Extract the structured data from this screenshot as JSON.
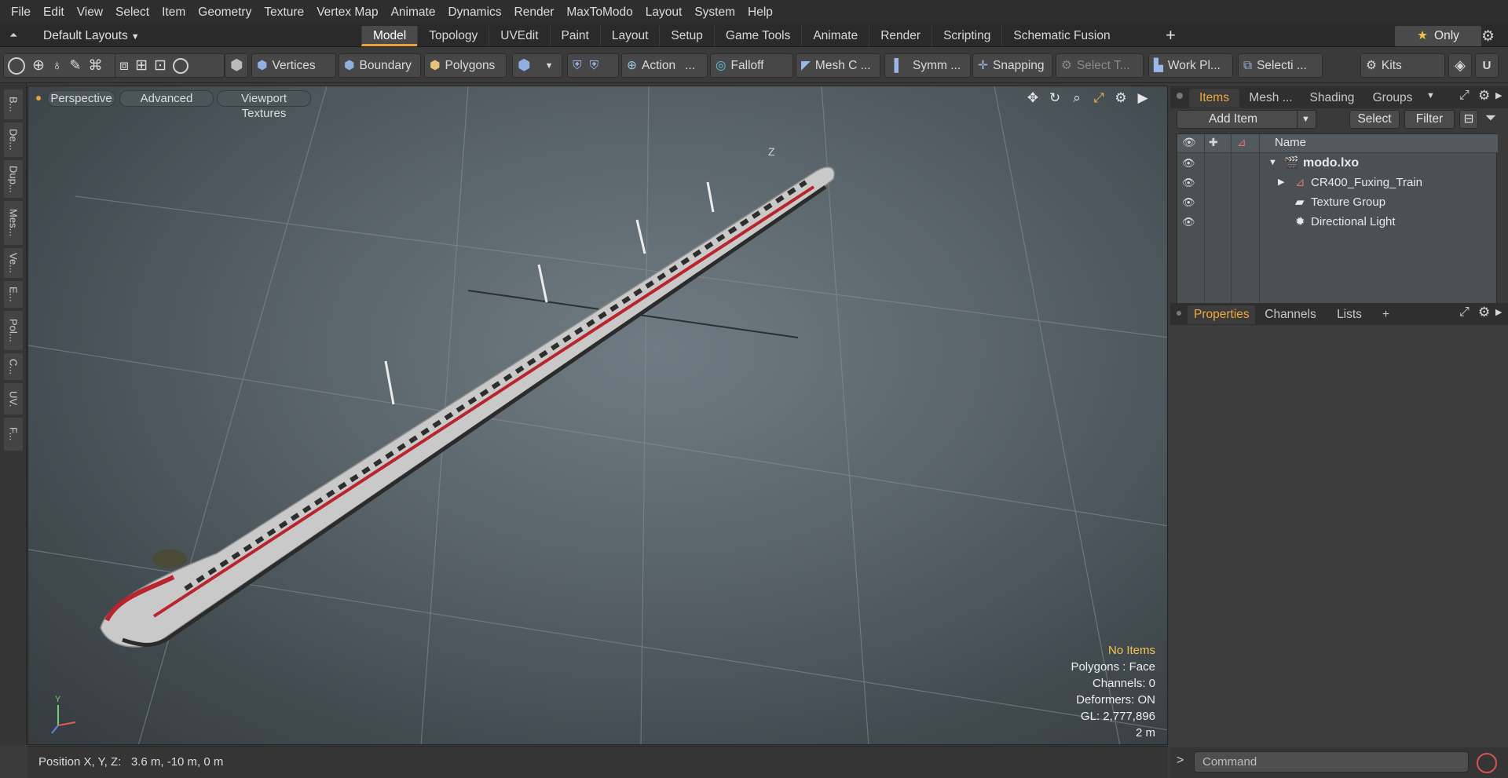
{
  "menu": [
    "File",
    "Edit",
    "View",
    "Select",
    "Item",
    "Geometry",
    "Texture",
    "Vertex Map",
    "Animate",
    "Dynamics",
    "Render",
    "MaxToModo",
    "Layout",
    "System",
    "Help"
  ],
  "layout_bar": {
    "default_layouts": "Default Layouts",
    "tabs": [
      "Model",
      "Topology",
      "UVEdit",
      "Paint",
      "Layout",
      "Setup",
      "Game Tools",
      "Animate",
      "Render",
      "Scripting",
      "Schematic Fusion"
    ],
    "active_tab": "Model",
    "add": "+",
    "only": "Only"
  },
  "toolbar": {
    "vertices": "Vertices",
    "boundary": "Boundary",
    "polygons": "Polygons",
    "action": "Action",
    "action_more": "...",
    "falloff": "Falloff",
    "mesh_c": "Mesh C ...",
    "symm": "Symm ...",
    "snapping": "Snapping",
    "select_t": "Select T...",
    "work_pl": "Work Pl...",
    "selecti": "Selecti ...",
    "kits": "Kits"
  },
  "left_tabs": [
    "B...",
    "De...",
    "Dup...",
    "Mes...",
    "Ve...",
    "E...",
    "Pol...",
    "C...",
    "UV.",
    "F..."
  ],
  "viewport": {
    "perspective": "Perspective",
    "advanced": "Advanced",
    "viewport_textures": "Viewport Textures",
    "stats": {
      "no_items": "No Items",
      "polygons": "Polygons : Face",
      "channels": "Channels: 0",
      "deformers": "Deformers: ON",
      "gl": "GL: 2,777,896",
      "scale": "2 m"
    },
    "axis_y": "Y",
    "axis_z_top": "Z"
  },
  "status": {
    "position_label": "Position X, Y, Z:",
    "position_value": "3.6 m, -10 m, 0 m"
  },
  "items_panel": {
    "tabs": [
      "Items",
      "Mesh ...",
      "Shading",
      "Groups"
    ],
    "active_tab": "Items",
    "add_item": "Add Item",
    "select": "Select",
    "filter": "Filter",
    "name_header": "Name",
    "rows": [
      {
        "label": "modo.lxo",
        "indent": 0,
        "bold": true
      },
      {
        "label": "CR400_Fuxing_Train",
        "indent": 1,
        "bold": false
      },
      {
        "label": "Texture Group",
        "indent": 1,
        "bold": false
      },
      {
        "label": "Directional Light",
        "indent": 1,
        "bold": false
      }
    ]
  },
  "properties_panel": {
    "tabs": [
      "Properties",
      "Channels",
      "Lists"
    ],
    "active_tab": "Properties",
    "add": "+"
  },
  "command": {
    "placeholder": "Command",
    "prompt": ">"
  },
  "colors": {
    "accent": "#e8a23c",
    "train_red": "#b8252c",
    "train_silver": "#d9d9d9"
  }
}
